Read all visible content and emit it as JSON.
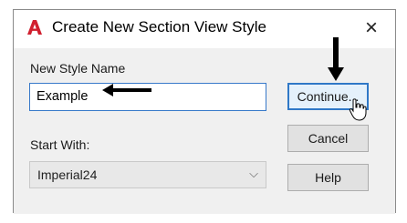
{
  "window": {
    "title": "Create New Section View Style",
    "close_glyph": "×",
    "app_icon": "autocad-a-icon"
  },
  "form": {
    "name_label": "New Style Name",
    "name_value": "Example",
    "start_label": "Start With:",
    "start_value": "Imperial24",
    "chevron_glyph": "⌵"
  },
  "buttons": {
    "continue": "Continue...",
    "cancel": "Cancel",
    "help": "Help"
  },
  "colors": {
    "brand_red": "#d1202f",
    "focus_blue": "#2f78c7"
  }
}
